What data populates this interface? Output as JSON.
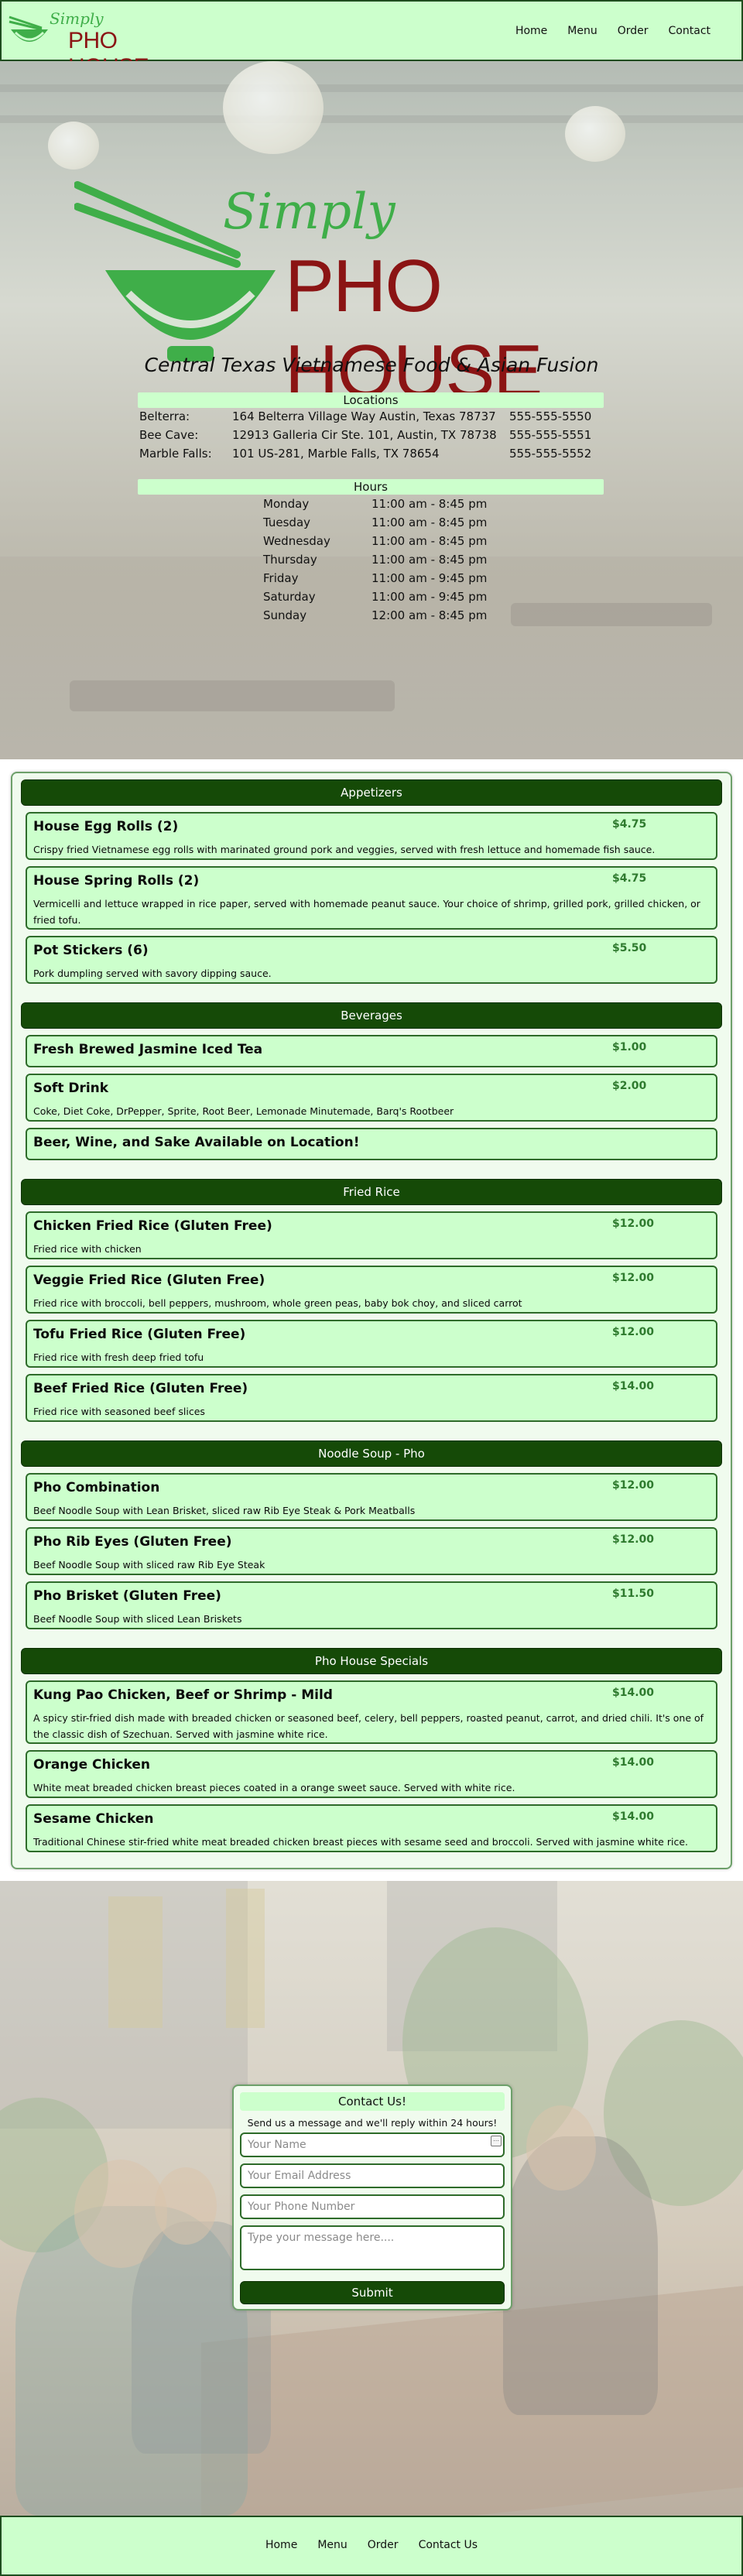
{
  "brand": {
    "simply": "Simply",
    "name": "PHO HOUSE",
    "green": "#3fae49",
    "red": "#8b1414"
  },
  "nav": {
    "items": [
      "Home",
      "Menu",
      "Order",
      "Contact"
    ]
  },
  "hero": {
    "tagline": "Central Texas Vietnamese Food & Asian Fusion",
    "locations_title": "Locations",
    "locations": [
      {
        "name": "Belterra:",
        "address": "164 Belterra Village Way Austin, Texas 78737",
        "phone": "555-555-5550"
      },
      {
        "name": "Bee Cave:",
        "address": "12913 Galleria Cir Ste. 101, Austin, TX 78738",
        "phone": "555-555-5551"
      },
      {
        "name": "Marble Falls:",
        "address": "101 US-281, Marble Falls, TX 78654",
        "phone": "555-555-5552"
      }
    ],
    "hours_title": "Hours",
    "hours": [
      {
        "day": "Monday",
        "time": "11:00 am - 8:45 pm"
      },
      {
        "day": "Tuesday",
        "time": "11:00 am - 8:45 pm"
      },
      {
        "day": "Wednesday",
        "time": "11:00 am - 8:45 pm"
      },
      {
        "day": "Thursday",
        "time": "11:00 am - 8:45 pm"
      },
      {
        "day": "Friday",
        "time": "11:00 am - 9:45 pm"
      },
      {
        "day": "Saturday",
        "time": "11:00 am - 9:45 pm"
      },
      {
        "day": "Sunday",
        "time": "12:00 am - 8:45 pm"
      }
    ]
  },
  "menu": {
    "sections": [
      {
        "title": "Appetizers",
        "items": [
          {
            "name": "House Egg Rolls (2)",
            "price": "$4.75",
            "desc": "Crispy fried Vietnamese egg rolls with marinated ground pork and veggies, served with fresh lettuce and homemade fish sauce."
          },
          {
            "name": "House Spring Rolls (2)",
            "price": "$4.75",
            "desc": "Vermicelli and lettuce wrapped in rice paper, served with homemade peanut sauce. Your choice of shrimp, grilled pork, grilled chicken, or fried tofu."
          },
          {
            "name": "Pot Stickers (6)",
            "price": "$5.50",
            "desc": "Pork dumpling served with savory dipping sauce."
          }
        ]
      },
      {
        "title": "Beverages",
        "items": [
          {
            "name": "Fresh Brewed Jasmine Iced Tea",
            "price": "$1.00",
            "desc": ""
          },
          {
            "name": "Soft Drink",
            "price": "$2.00",
            "desc": "Coke, Diet Coke, DrPepper, Sprite, Root Beer, Lemonade Minutemade, Barq's Rootbeer"
          },
          {
            "name": "Beer, Wine, and Sake Available on Location!",
            "price": "",
            "desc": ""
          }
        ]
      },
      {
        "title": "Fried Rice",
        "items": [
          {
            "name": "Chicken Fried Rice (Gluten Free)",
            "price": "$12.00",
            "desc": "Fried rice with chicken"
          },
          {
            "name": "Veggie Fried Rice (Gluten Free)",
            "price": "$12.00",
            "desc": "Fried rice with broccoli, bell peppers, mushroom, whole green peas, baby bok choy, and sliced carrot"
          },
          {
            "name": "Tofu Fried Rice (Gluten Free)",
            "price": "$12.00",
            "desc": "Fried rice with fresh deep fried tofu"
          },
          {
            "name": "Beef Fried Rice (Gluten Free)",
            "price": "$14.00",
            "desc": "Fried rice with seasoned beef slices"
          }
        ]
      },
      {
        "title": "Noodle Soup - Pho",
        "items": [
          {
            "name": "Pho Combination",
            "price": "$12.00",
            "desc": "Beef Noodle Soup with Lean Brisket, sliced raw Rib Eye Steak & Pork Meatballs"
          },
          {
            "name": "Pho Rib Eyes (Gluten Free)",
            "price": "$12.00",
            "desc": "Beef Noodle Soup with sliced raw Rib Eye Steak"
          },
          {
            "name": "Pho Brisket (Gluten Free)",
            "price": "$11.50",
            "desc": "Beef Noodle Soup with sliced Lean Briskets"
          }
        ]
      },
      {
        "title": "Pho House Specials",
        "items": [
          {
            "name": "Kung Pao Chicken, Beef or Shrimp - Mild",
            "price": "$14.00",
            "desc": "A spicy stir-fried dish made with breaded chicken or seasoned beef, celery, bell peppers, roasted peanut, carrot, and dried chili. It's one of the classic dish of Szechuan. Served with jasmine white rice."
          },
          {
            "name": "Orange Chicken",
            "price": "$14.00",
            "desc": "White meat breaded chicken breast pieces coated in a orange sweet sauce. Served with white rice."
          },
          {
            "name": "Sesame Chicken",
            "price": "$14.00",
            "desc": "Traditional Chinese stir-fried white meat breaded chicken breast pieces with sesame seed and broccoli. Served with jasmine white rice."
          }
        ]
      }
    ]
  },
  "contact": {
    "title": "Contact Us!",
    "subtitle": "Send us a message and we'll reply within 24 hours!",
    "name_placeholder": "Your Name",
    "email_placeholder": "Your Email Address",
    "phone_placeholder": "Your Phone Number",
    "message_placeholder": "Type your message here....",
    "submit_label": "Submit"
  },
  "footer": {
    "items": [
      "Home",
      "Menu",
      "Order",
      "Contact Us"
    ]
  }
}
